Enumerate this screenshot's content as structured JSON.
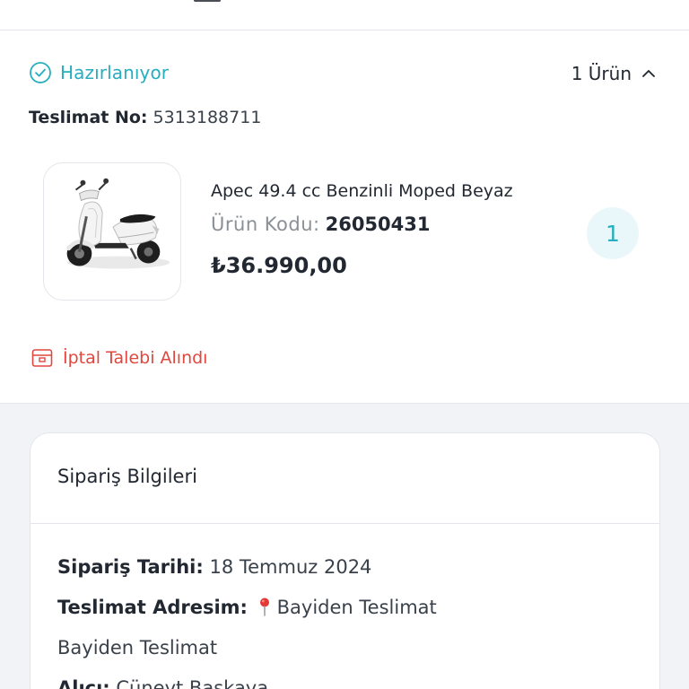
{
  "delivery": {
    "status": "Hazırlanıyor",
    "item_count": "1 Ürün",
    "tracking_label": "Teslimat No:",
    "tracking_number": "5313188711",
    "status_color": "#27aebf"
  },
  "product": {
    "name": "Apec 49.4 cc Benzinli Moped Beyaz",
    "code_label": "Ürün Kodu:",
    "code": "26050431",
    "price": "₺36.990,00",
    "quantity": "1",
    "image_icon": "scooter-image"
  },
  "cancellation": {
    "text": "İptal Talebi Alındı",
    "color": "#e0473e"
  },
  "order_info": {
    "title": "Sipariş Bilgileri",
    "date_label": "Sipariş Tarihi:",
    "date_value": "18 Temmuz 2024",
    "address_label": "Teslimat Adresim:",
    "address_value": "Bayiden Teslimat",
    "address_detail": "Bayiden Teslimat",
    "recipient_label": "Alıcı:",
    "recipient_value": "Cüneyt Başkaya"
  }
}
